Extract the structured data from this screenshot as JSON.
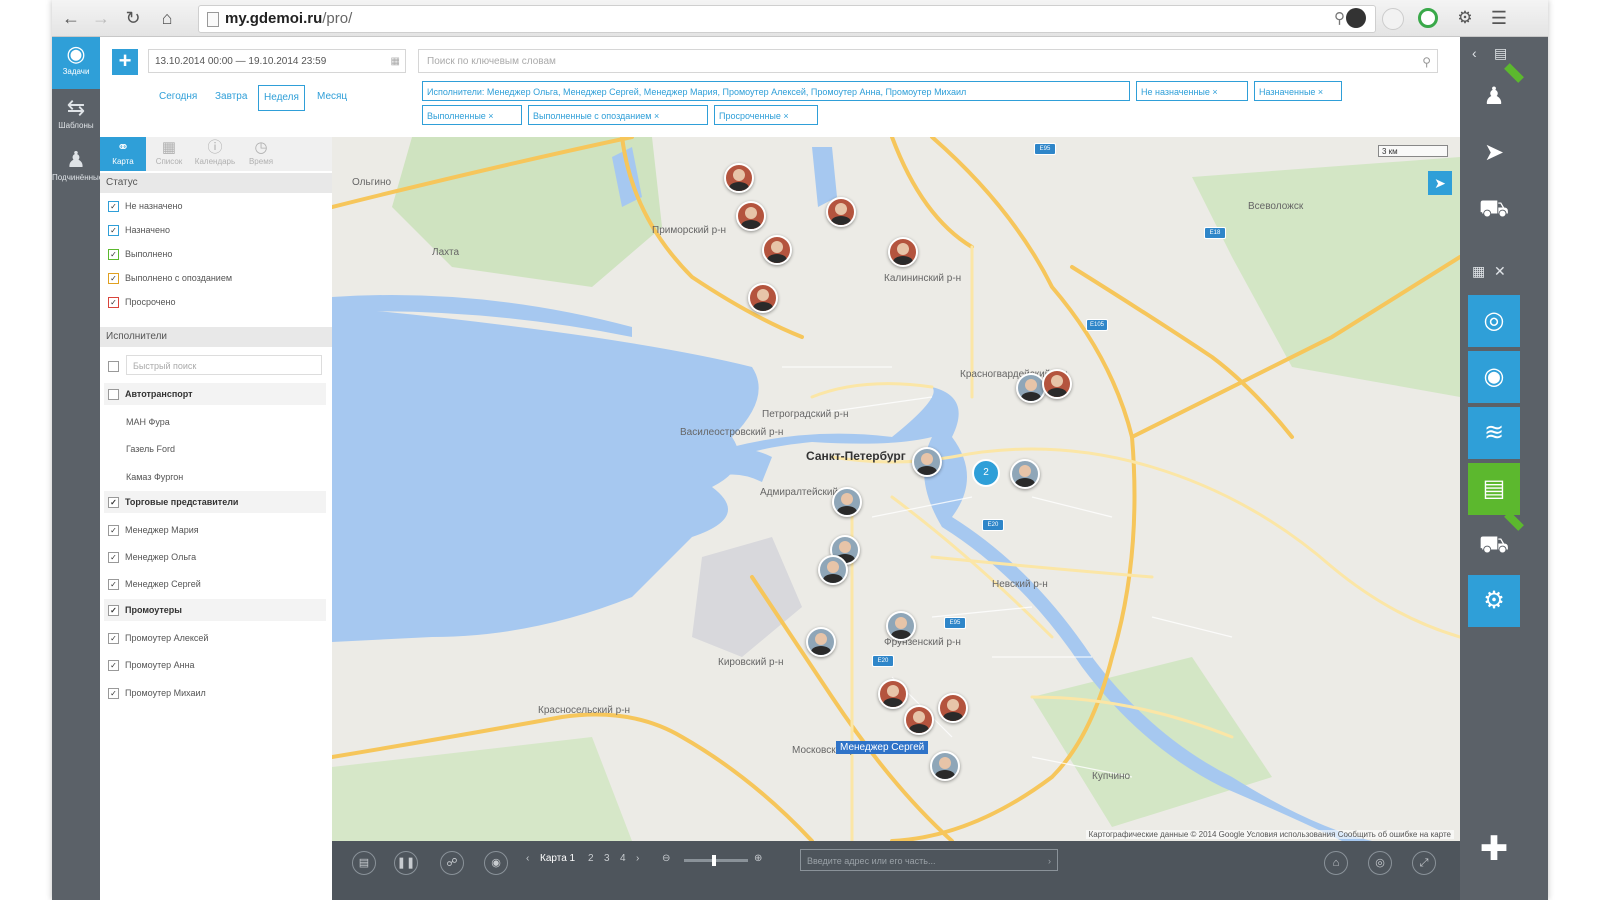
{
  "browser": {
    "domain": "my.gdemoi.ru",
    "path": "/pro/",
    "back_icon": "arrow-left-icon",
    "forward_icon": "arrow-right-icon",
    "reload_icon": "reload-icon",
    "home_icon": "home-icon"
  },
  "leftnav": {
    "items": [
      {
        "label": "Задачи",
        "icon": "task-pin-icon"
      },
      {
        "label": "Шаблоны",
        "icon": "exchange-icon"
      },
      {
        "label": "Подчинённые",
        "icon": "people-icon"
      }
    ]
  },
  "toolbar": {
    "add_label": "+",
    "date_range": "13.10.2014 00:00 — 19.10.2014 23:59",
    "periods": [
      "Сегодня",
      "Завтра",
      "Неделя",
      "Месяц"
    ],
    "selected_period": "Неделя",
    "search_placeholder": "Поиск по ключевым словам",
    "chips": [
      "Исполнители: Менеджер Ольга, Менеджер Сергей, Менеджер Мария, Промоутер Алексей, Промоутер Анна, Промоутер Михаил",
      "Не назначенные ×",
      "Назначенные ×",
      "Выполненные ×",
      "Выполненные с опозданием ×",
      "Просроченные ×"
    ]
  },
  "panel": {
    "tabs": [
      "Карта",
      "Список",
      "Календарь",
      "Время"
    ],
    "status_header": "Статус",
    "statuses": [
      {
        "label": "Не назначено",
        "color": "#2f9fd8"
      },
      {
        "label": "Назначено",
        "color": "#2f9fd8"
      },
      {
        "label": "Выполнено",
        "color": "#5cb82e"
      },
      {
        "label": "Выполнено с опозданием",
        "color": "#e0a020"
      },
      {
        "label": "Просрочено",
        "color": "#d9453c"
      }
    ],
    "executors_header": "Исполнители",
    "quick_search_placeholder": "Быстрый поиск",
    "groups": [
      {
        "label": "Автотранспорт",
        "checked": false,
        "members": [
          "МАН Фура",
          "Газель Ford",
          "Камаз Фургон"
        ]
      },
      {
        "label": "Торговые представители",
        "checked": true,
        "members": [
          "Менеджер Мария",
          "Менеджер Ольга",
          "Менеджер Сергей"
        ]
      },
      {
        "label": "Промоутеры",
        "checked": true,
        "members": [
          "Промоутер Алексей",
          "Промоутер Анна",
          "Промоутер Михаил"
        ]
      }
    ]
  },
  "map": {
    "labels": {
      "primorsky": "Приморский р-н",
      "kalininsky": "Калининский р-н",
      "krasnogvardeysky": "Красногвардейский р-н",
      "petrogradsky": "Петроградский р-н",
      "vasileostrovsky": "Василеостровский р-н",
      "spb": "Санкт-Петербург",
      "admiralteysky": "Адмиралтейский р-н",
      "nevsky": "Невский р-н",
      "frunzensky": "Фрунзенский р-н",
      "kirovsky": "Кировский р-н",
      "krasnoselsky": "Красносельский р-н",
      "moskovsky": "Московский р-н",
      "vsevolozhsk": "Всеволожск",
      "lakhta": "Лахта",
      "olgino": "Ольгино",
      "kupchino": "Купчино"
    },
    "cluster_count": "2",
    "selected_label": "Менеджер Сергей",
    "scale_label": "3 км",
    "copyright": "Картографические данные © 2014 Google   Условия использования   Сообщить об ошибке на карте"
  },
  "bottombar": {
    "map_tab": "Карта 1",
    "pages": [
      "2",
      "3",
      "4"
    ],
    "address_placeholder": "Введите адрес или его часть..."
  },
  "rightbar": {
    "items": [
      "user-icon",
      "navigation-arrow-icon",
      "car-signal-icon",
      "globe-icon",
      "location-pin-icon",
      "chart-icon",
      "document-icon",
      "vehicle-icon",
      "settings-gears-icon"
    ],
    "add_icon": "plus-icon"
  },
  "colors": {
    "accent": "#2f9fd8",
    "sidebar": "#5b6168",
    "green": "#5cb82e",
    "water": "#a6c8f0"
  }
}
